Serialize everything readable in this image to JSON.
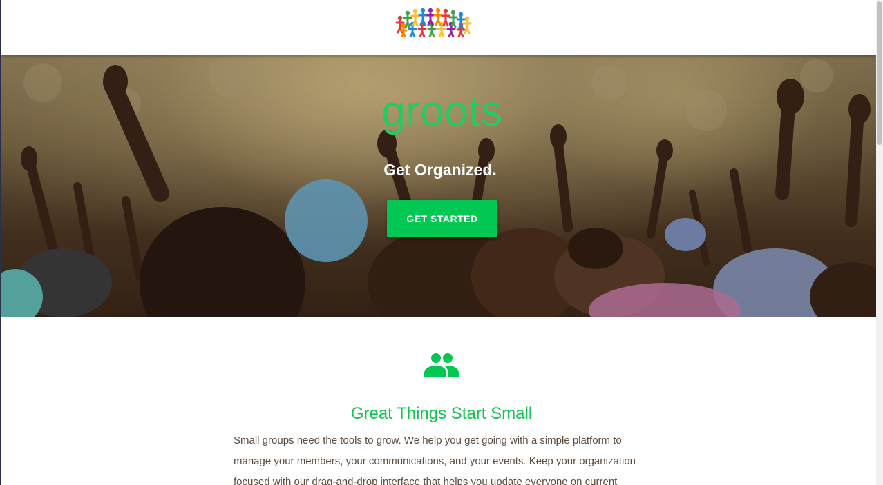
{
  "header": {
    "logo_icon": "people-circle-logo"
  },
  "hero": {
    "title": "groots",
    "subtitle": "Get Organized.",
    "cta_label": "GET STARTED",
    "background": "crowd-raising-hands-photo"
  },
  "feature": {
    "icon": "group-icon",
    "title": "Great Things Start Small",
    "body": "Small groups need the tools to grow. We help you get going with a simple platform to manage your members, your communications, and your events. Keep your organization focused with our drag-and-drop interface that helps you update everyone on current"
  },
  "colors": {
    "brand_green": "#00c853",
    "title_green": "#21cc61",
    "body_text": "#5d4c3e"
  }
}
